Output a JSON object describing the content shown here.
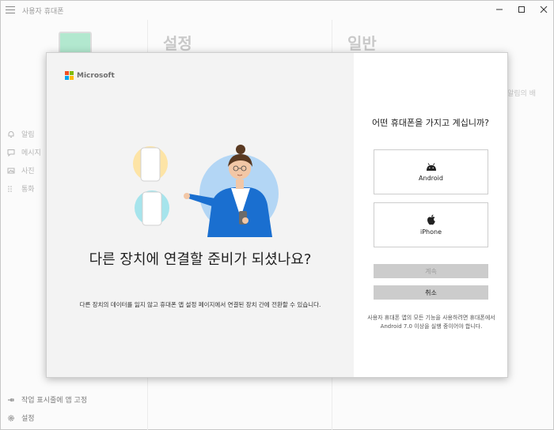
{
  "app": {
    "title": "사용자 휴대폰",
    "window_controls": [
      "minimize",
      "maximize",
      "close"
    ]
  },
  "sidebar": {
    "items": [
      {
        "label": "알림",
        "icon": "bell-icon"
      },
      {
        "label": "메시지",
        "icon": "message-icon"
      },
      {
        "label": "사진",
        "icon": "photo-icon"
      },
      {
        "label": "통화",
        "icon": "dialpad-icon"
      }
    ],
    "bottom": [
      {
        "label": "작업 표시줄에 앱 고정",
        "icon": "pin-icon"
      },
      {
        "label": "설정",
        "icon": "gear-icon"
      }
    ]
  },
  "settings_header": "설정",
  "general_header": "일반",
  "side_note": "알림의 배",
  "dialog": {
    "brand": "Microsoft",
    "headline": "다른 장치에 연결할 준비가 되셨나요?",
    "description": "다른 장치의 데이터를 잃지 않고 휴대폰 앱 설정 페이지에서 연결된 장치 간에 전환할 수 있습니다.",
    "question": "어떤 휴대폰을 가지고 계십니까?",
    "options": [
      {
        "label": "Android",
        "icon": "android-icon"
      },
      {
        "label": "iPhone",
        "icon": "apple-icon"
      }
    ],
    "continue_label": "계속",
    "cancel_label": "취소",
    "footnote": "사용자 휴대폰 앱의 모든 기능을 사용하려면 휴대폰에서 Android 7.0 이상을 실행 중이어야 합니다."
  },
  "colors": {
    "ms_red": "#f25022",
    "ms_green": "#7fba00",
    "ms_blue": "#00a4ef",
    "ms_yellow": "#ffb900",
    "accent_blue": "#1a6fd0"
  }
}
